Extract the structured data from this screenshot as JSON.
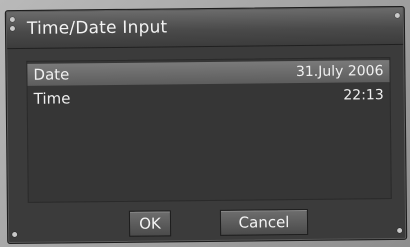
{
  "dialog": {
    "title": "Time/Date Input"
  },
  "fields": [
    {
      "label": "Date",
      "value": "31.July 2006"
    },
    {
      "label": "Time",
      "value": "22:13"
    }
  ],
  "buttons": {
    "ok_label": "OK",
    "cancel_label": "Cancel"
  },
  "colors": {
    "dialog_bg": "#3b3b3b",
    "selection": "#6b6b6b",
    "text": "#f0f0f0"
  }
}
